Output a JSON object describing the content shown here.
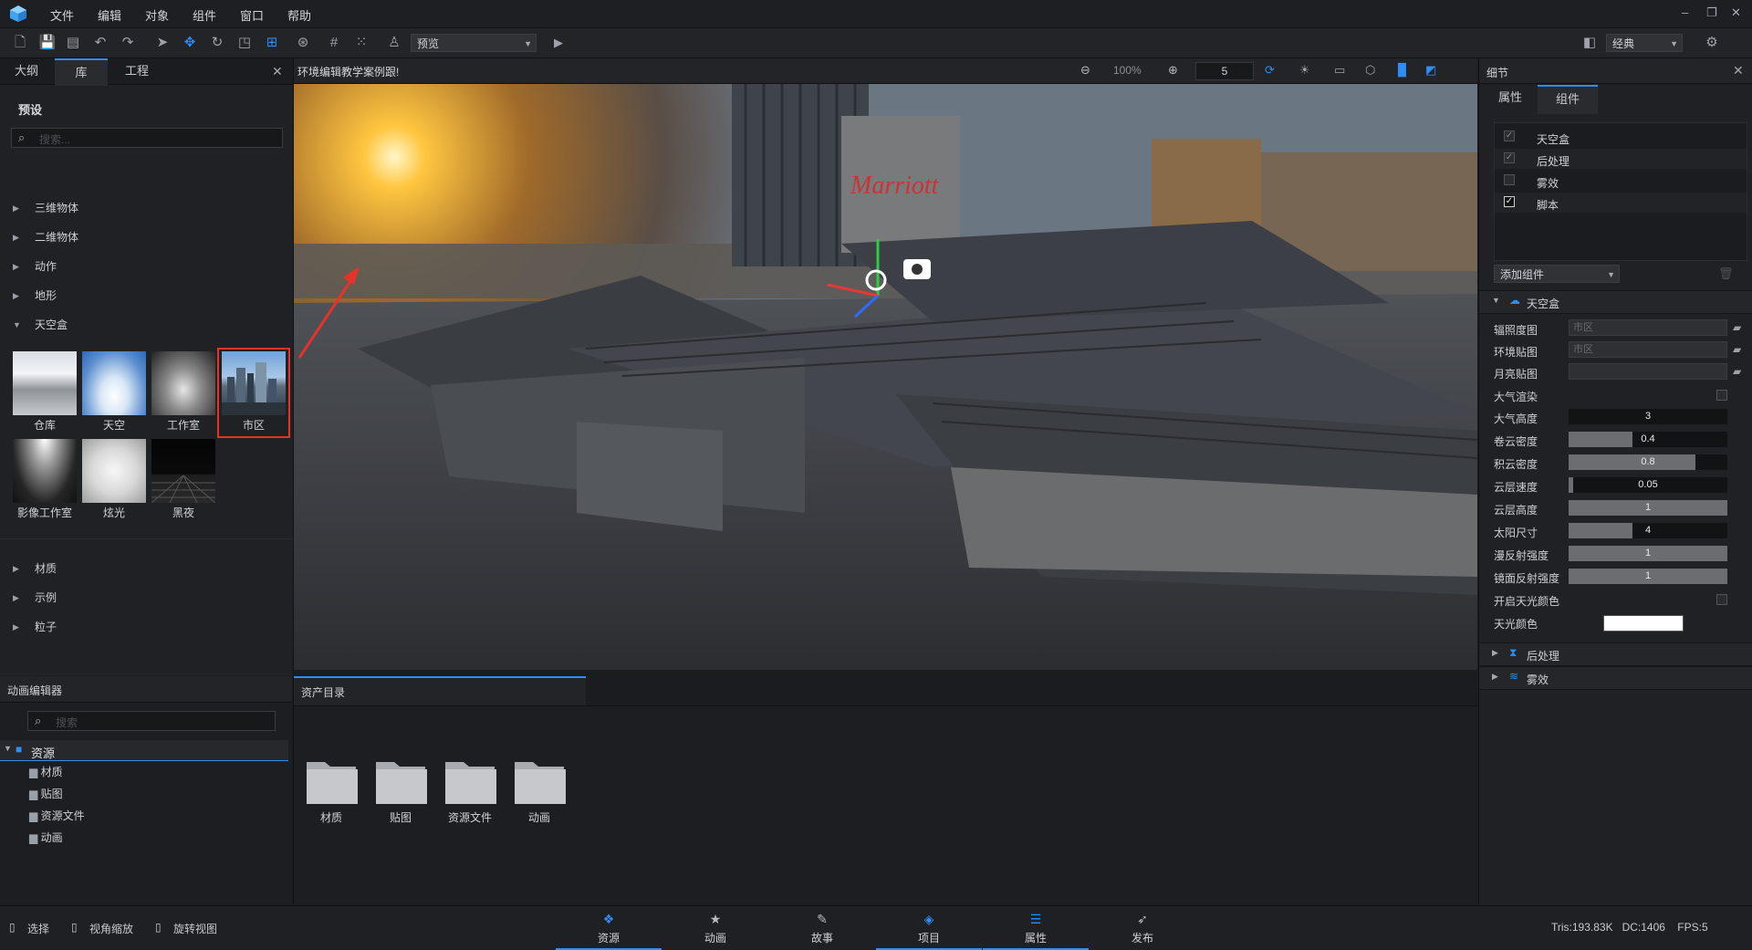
{
  "menu": {
    "items": [
      "文件",
      "编辑",
      "对象",
      "组件",
      "窗口",
      "帮助"
    ]
  },
  "window_controls": {
    "minimize": "–",
    "restore": "❐",
    "close": "✕"
  },
  "toolbar": {
    "preview_dropdown": "预览",
    "layout_dropdown": "经典"
  },
  "left_panel": {
    "tabs": [
      "大纲",
      "库",
      "工程"
    ],
    "active_tab": "库",
    "section_title": "预设",
    "search_placeholder": "搜索...",
    "categories_top": [
      "三维物体",
      "二维物体",
      "动作",
      "地形",
      "天空盒"
    ],
    "skyboxes": [
      "仓库",
      "天空",
      "工作室",
      "市区",
      "影像工作室",
      "炫光",
      "黑夜"
    ],
    "selected_skybox": "市区",
    "categories_bottom": [
      "材质",
      "示例",
      "粒子"
    ]
  },
  "viewport": {
    "title": "环境编辑教学案例跟!",
    "zoom": "100%",
    "speed": "5"
  },
  "anim_panel": {
    "title": "动画编辑器",
    "search_placeholder": "搜索",
    "tree_root": "资源",
    "tree_children": [
      "材质",
      "贴图",
      "资源文件",
      "动画"
    ]
  },
  "asset_panel": {
    "title": "资产目录",
    "folders": [
      "材质",
      "贴图",
      "资源文件",
      "动画"
    ]
  },
  "right_panel": {
    "title": "细节",
    "tabs": [
      "属性",
      "组件"
    ],
    "active_tab": "组件",
    "components": [
      {
        "label": "天空盒",
        "checked": true
      },
      {
        "label": "后处理",
        "checked": true
      },
      {
        "label": "雾效",
        "checked": false
      },
      {
        "label": "脚本",
        "checked": true
      }
    ],
    "add_component": "添加组件",
    "skybox_section": "天空盒",
    "props": {
      "irradiance_map": {
        "name": "辐照度图",
        "value": "市区"
      },
      "env_map": {
        "name": "环境贴图",
        "value": "市区"
      },
      "moon_map": {
        "name": "月亮贴图",
        "value": ""
      },
      "atmosphere_render": {
        "name": "大气渲染"
      },
      "atmo_height": {
        "name": "大气高度",
        "value": "3",
        "fill": 0.0
      },
      "cirrus_density": {
        "name": "卷云密度",
        "value": "0.4",
        "fill": 0.4
      },
      "cumulus_density": {
        "name": "积云密度",
        "value": "0.8",
        "fill": 0.8
      },
      "cloud_speed": {
        "name": "云层速度",
        "value": "0.05",
        "fill": 0.03
      },
      "cloud_height": {
        "name": "云层高度",
        "value": "1",
        "fill": 1.0
      },
      "sun_size": {
        "name": "太阳尺寸",
        "value": "4",
        "fill": 0.4
      },
      "diffuse_strength": {
        "name": "漫反射强度",
        "value": "1",
        "fill": 1.0
      },
      "specular_strength": {
        "name": "镜面反射强度",
        "value": "1",
        "fill": 1.0
      },
      "sky_color_toggle": {
        "name": "开启天光颜色"
      },
      "sky_color": {
        "name": "天光颜色",
        "value": "#ffffff"
      }
    },
    "sections_collapsed": [
      "后处理",
      "雾效"
    ]
  },
  "statusbar": {
    "hints": [
      "选择",
      "视角缩放",
      "旋转视图"
    ],
    "tabs": [
      "资源",
      "动画",
      "故事",
      "项目",
      "属性",
      "发布"
    ],
    "stats": "Tris:193.83K   DC:1406    FPS:5"
  },
  "colors": {
    "accent": "#2f8df3",
    "highlight_border": "#e5332a",
    "panel": "#202124"
  }
}
